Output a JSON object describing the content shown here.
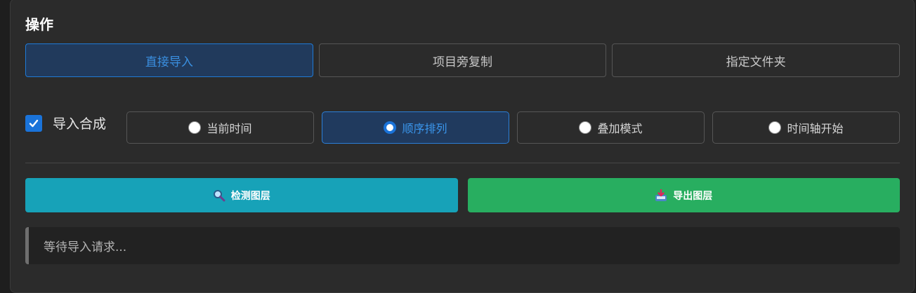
{
  "section": {
    "title": "操作"
  },
  "import_modes": [
    {
      "label": "直接导入",
      "active": true
    },
    {
      "label": "项目旁复制",
      "active": false
    },
    {
      "label": "指定文件夹",
      "active": false
    }
  ],
  "import_comp": {
    "label": "导入合成",
    "checked": true
  },
  "placement": [
    {
      "label": "当前时间",
      "selected": false
    },
    {
      "label": "顺序排列",
      "selected": true
    },
    {
      "label": "叠加模式",
      "selected": false
    },
    {
      "label": "时间轴开始",
      "selected": false
    }
  ],
  "actions": {
    "detect": {
      "label": "检测图层",
      "icon": "magnifier-icon",
      "color": "#17a2b8"
    },
    "export": {
      "label": "导出图层",
      "icon": "inbox-tray-icon",
      "color": "#28ae60"
    }
  },
  "status": {
    "text": "等待导入请求..."
  },
  "colors": {
    "accent_blue": "#1a73d9",
    "panel_bg": "#2b2b2b"
  }
}
